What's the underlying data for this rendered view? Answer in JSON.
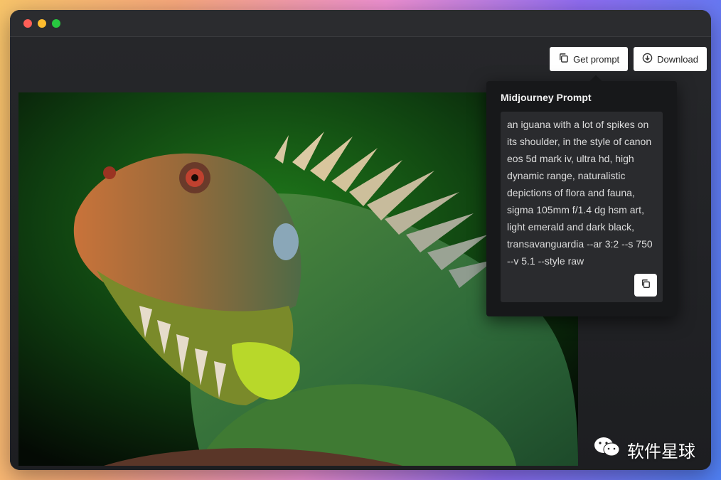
{
  "toolbar": {
    "get_prompt_label": "Get prompt",
    "download_label": "Download"
  },
  "popover": {
    "title": "Midjourney Prompt",
    "prompt_text": "an iguana with a lot of spikes on its shoulder, in the style of canon eos 5d mark iv, ultra hd, high dynamic range, naturalistic depictions of flora and fauna, sigma 105mm f/1.4 dg hsm art, light emerald and dark black, transavanguardia --ar 3:2 --s 750 --v 5.1 --style raw"
  },
  "watermark": {
    "text": "软件星球"
  },
  "colors": {
    "window_bg": "#202124",
    "popover_bg": "#17181a",
    "prompt_box_bg": "#2a2b2e",
    "button_bg": "#ffffff"
  },
  "icons": [
    "copy-icon",
    "download-icon",
    "wechat-icon"
  ]
}
